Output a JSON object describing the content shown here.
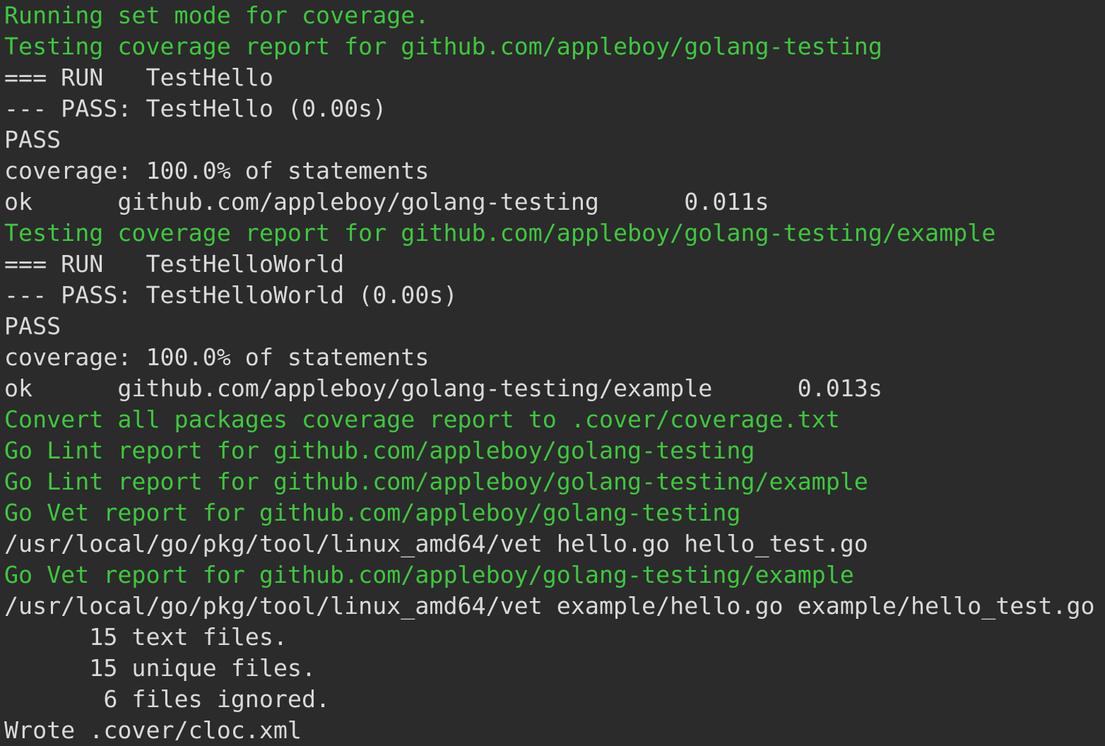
{
  "colors": {
    "background": "#2b2b2b",
    "default_text": "#dadada",
    "highlight_text": "#3fc73f"
  },
  "terminal": {
    "lines": [
      {
        "text": "Running set mode for coverage.",
        "color": "green"
      },
      {
        "text": "Testing coverage report for github.com/appleboy/golang-testing",
        "color": "green"
      },
      {
        "text": "=== RUN   TestHello",
        "color": "default"
      },
      {
        "text": "--- PASS: TestHello (0.00s)",
        "color": "default"
      },
      {
        "text": "PASS",
        "color": "default"
      },
      {
        "text": "coverage: 100.0% of statements",
        "color": "default"
      },
      {
        "text": "ok      github.com/appleboy/golang-testing      0.011s",
        "color": "default"
      },
      {
        "text": "Testing coverage report for github.com/appleboy/golang-testing/example",
        "color": "green"
      },
      {
        "text": "=== RUN   TestHelloWorld",
        "color": "default"
      },
      {
        "text": "--- PASS: TestHelloWorld (0.00s)",
        "color": "default"
      },
      {
        "text": "PASS",
        "color": "default"
      },
      {
        "text": "coverage: 100.0% of statements",
        "color": "default"
      },
      {
        "text": "ok      github.com/appleboy/golang-testing/example      0.013s",
        "color": "default"
      },
      {
        "text": "Convert all packages coverage report to .cover/coverage.txt",
        "color": "green"
      },
      {
        "text": "Go Lint report for github.com/appleboy/golang-testing",
        "color": "green"
      },
      {
        "text": "Go Lint report for github.com/appleboy/golang-testing/example",
        "color": "green"
      },
      {
        "text": "Go Vet report for github.com/appleboy/golang-testing",
        "color": "green"
      },
      {
        "text": "/usr/local/go/pkg/tool/linux_amd64/vet hello.go hello_test.go",
        "color": "default"
      },
      {
        "text": "Go Vet report for github.com/appleboy/golang-testing/example",
        "color": "green"
      },
      {
        "text": "/usr/local/go/pkg/tool/linux_amd64/vet example/hello.go example/hello_test.go",
        "color": "default"
      },
      {
        "text": "      15 text files.",
        "color": "default"
      },
      {
        "text": "      15 unique files.",
        "color": "default"
      },
      {
        "text": "       6 files ignored.",
        "color": "default"
      },
      {
        "text": "Wrote .cover/cloc.xml",
        "color": "default"
      }
    ]
  }
}
